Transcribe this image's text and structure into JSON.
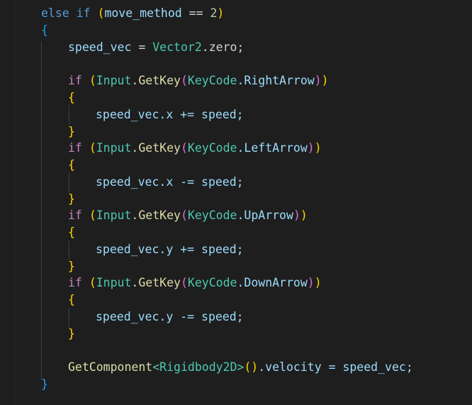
{
  "code": {
    "l1": {
      "else": "else",
      "if": "if",
      "paren_open": "(",
      "var": "move_method",
      "op": " == ",
      "num": "2",
      "paren_close": ")"
    },
    "l2": {
      "brace": "{"
    },
    "l3": {
      "var": "speed_vec",
      "op": " = ",
      "type": "Vector2",
      "rest": ".zero;"
    },
    "l4": {
      "if": "if",
      "p_open": "(",
      "obj": "Input",
      "dot": ".",
      "method": "GetKey",
      "m_open": "(",
      "enum": "KeyCode",
      "member": ".RightArrow",
      "m_close": ")",
      "p_close": ")"
    },
    "l5": {
      "brace": "{"
    },
    "l6": {
      "stmt": "speed_vec.x += speed;"
    },
    "l7": {
      "brace": "}"
    },
    "l8": {
      "if": "if",
      "p_open": "(",
      "obj": "Input",
      "dot": ".",
      "method": "GetKey",
      "m_open": "(",
      "enum": "KeyCode",
      "member": ".LeftArrow",
      "m_close": ")",
      "p_close": ")"
    },
    "l9": {
      "brace": "{"
    },
    "l10": {
      "stmt": "speed_vec.x -= speed;"
    },
    "l11": {
      "brace": "}"
    },
    "l12": {
      "if": "if",
      "p_open": "(",
      "obj": "Input",
      "dot": ".",
      "method": "GetKey",
      "m_open": "(",
      "enum": "KeyCode",
      "member": ".UpArrow",
      "m_close": ")",
      "p_close": ")"
    },
    "l13": {
      "brace": "{"
    },
    "l14": {
      "stmt": "speed_vec.y += speed;"
    },
    "l15": {
      "brace": "}"
    },
    "l16": {
      "if": "if",
      "p_open": "(",
      "obj": "Input",
      "dot": ".",
      "method": "GetKey",
      "m_open": "(",
      "enum": "KeyCode",
      "member": ".DownArrow",
      "m_close": ")",
      "p_close": ")"
    },
    "l17": {
      "brace": "{"
    },
    "l18": {
      "stmt": "speed_vec.y -= speed;"
    },
    "l19": {
      "brace": "}"
    },
    "l20": {
      "method": "GetComponent",
      "generic": "<Rigidbody2D>",
      "call": "()",
      "rest": ".velocity = speed_vec;"
    },
    "l21": {
      "brace": "}"
    }
  },
  "colors": {
    "background": "#1e1e1e",
    "keyword": "#569cd6",
    "control": "#c586c0",
    "variable": "#9cdcfe",
    "type": "#4ec9b0",
    "function": "#dcdcaa",
    "number": "#b5cea8",
    "bracket1": "#ffd700",
    "bracket2": "#da70d6",
    "bracket3": "#179fff"
  }
}
